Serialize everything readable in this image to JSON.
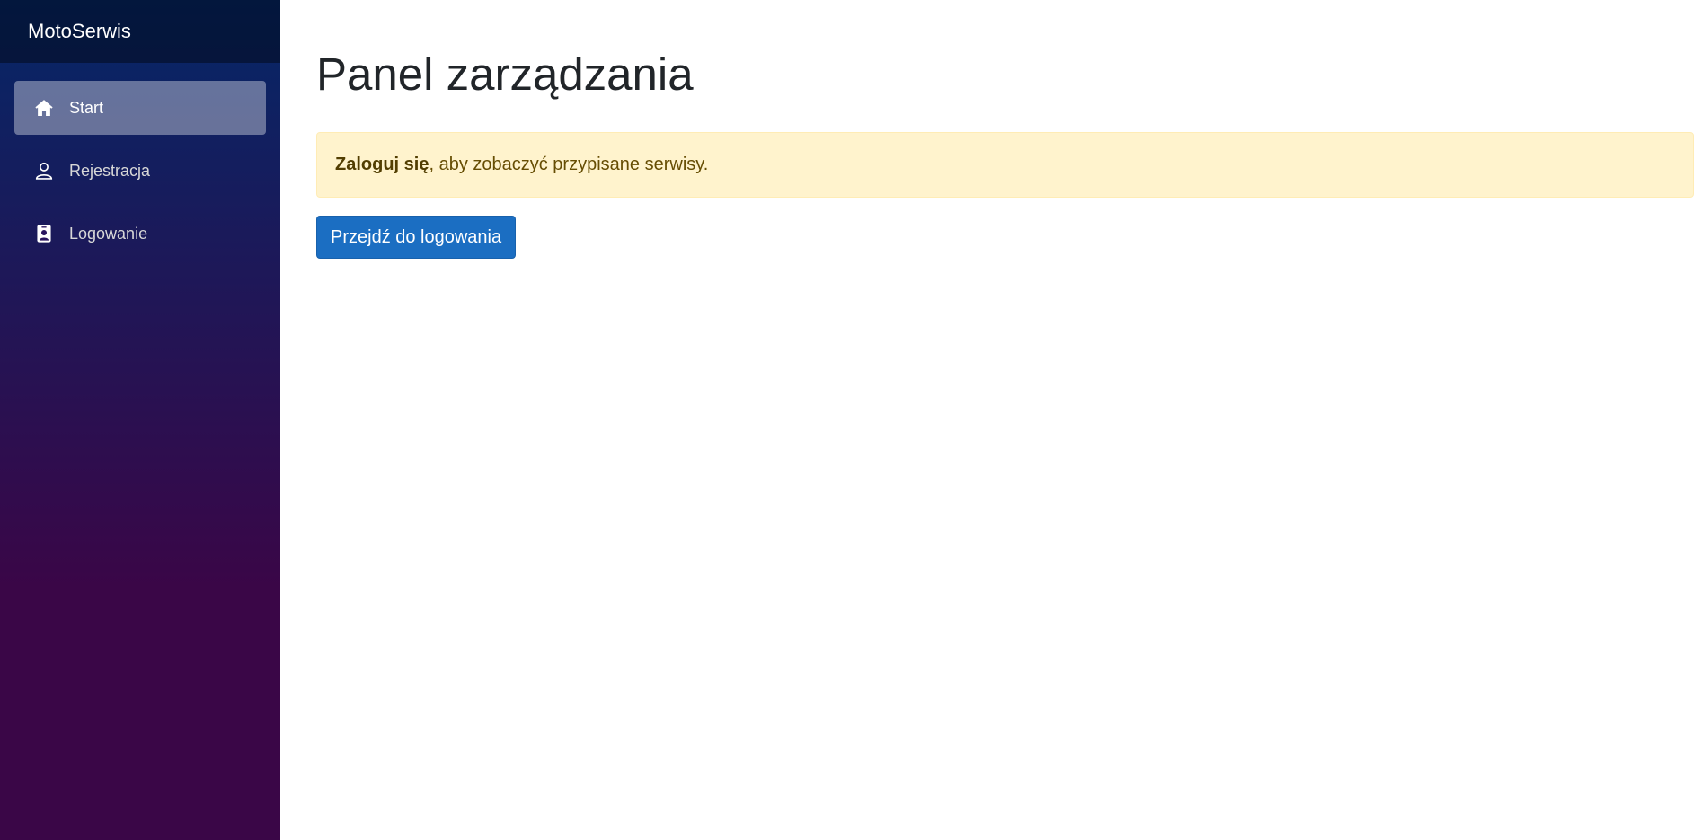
{
  "app": {
    "brand": "MotoSerwis"
  },
  "sidebar": {
    "items": [
      {
        "label": "Start",
        "icon": "house-icon",
        "active": true
      },
      {
        "label": "Rejestracja",
        "icon": "person-icon",
        "active": false
      },
      {
        "label": "Logowanie",
        "icon": "person-badge-icon",
        "active": false
      }
    ]
  },
  "main": {
    "title": "Panel zarządzania",
    "alert": {
      "strong": "Zaloguj się",
      "text": ", aby zobaczyć przypisane serwisy."
    },
    "login_button": "Przejdź do logowania"
  },
  "colors": {
    "sidebar_top": "#052767",
    "sidebar_bottom": "#3a0647",
    "alert_bg": "#fff3cd",
    "button_bg": "#1b6ec2"
  }
}
